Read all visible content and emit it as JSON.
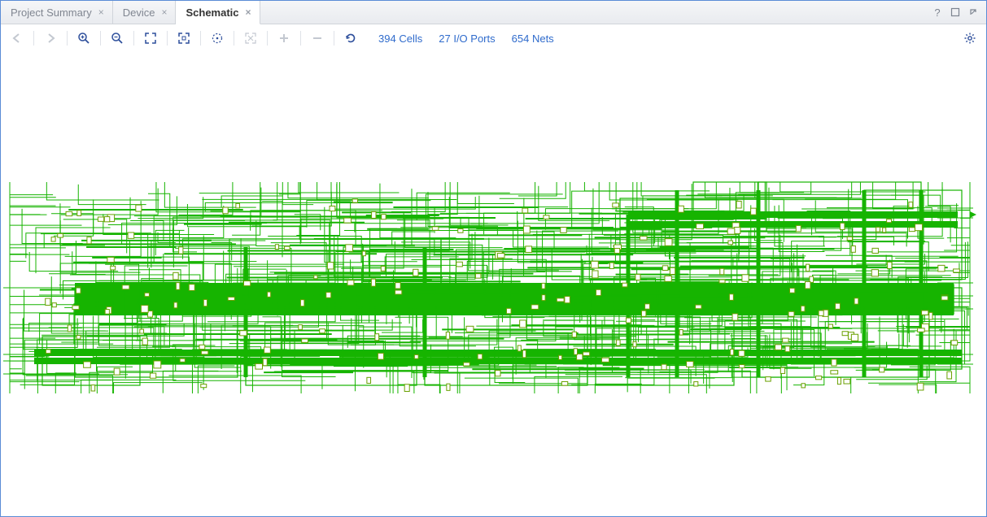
{
  "tabs": [
    {
      "label": "Project Summary",
      "active": false
    },
    {
      "label": "Device",
      "active": false
    },
    {
      "label": "Schematic",
      "active": true
    }
  ],
  "titlebar_icons": {
    "help": "?",
    "maximize": "□",
    "float": "⇱"
  },
  "toolbar": {
    "back": "←",
    "forward": "→",
    "zoom_in": "+",
    "zoom_out": "−",
    "zoom_fit": "⤢",
    "zoom_area": "⛶",
    "auto_fit": "◌",
    "highlight": "▢",
    "add": "＋",
    "remove": "—",
    "regenerate": "↻",
    "settings": "⚙"
  },
  "stats": {
    "cells": {
      "count": "394",
      "label": "Cells"
    },
    "ports": {
      "count": "27",
      "label": "I/O Ports"
    },
    "nets": {
      "count": "654",
      "label": "Nets"
    }
  },
  "schematic": {
    "color": "#16b400",
    "description": "netlist schematic rendering"
  }
}
